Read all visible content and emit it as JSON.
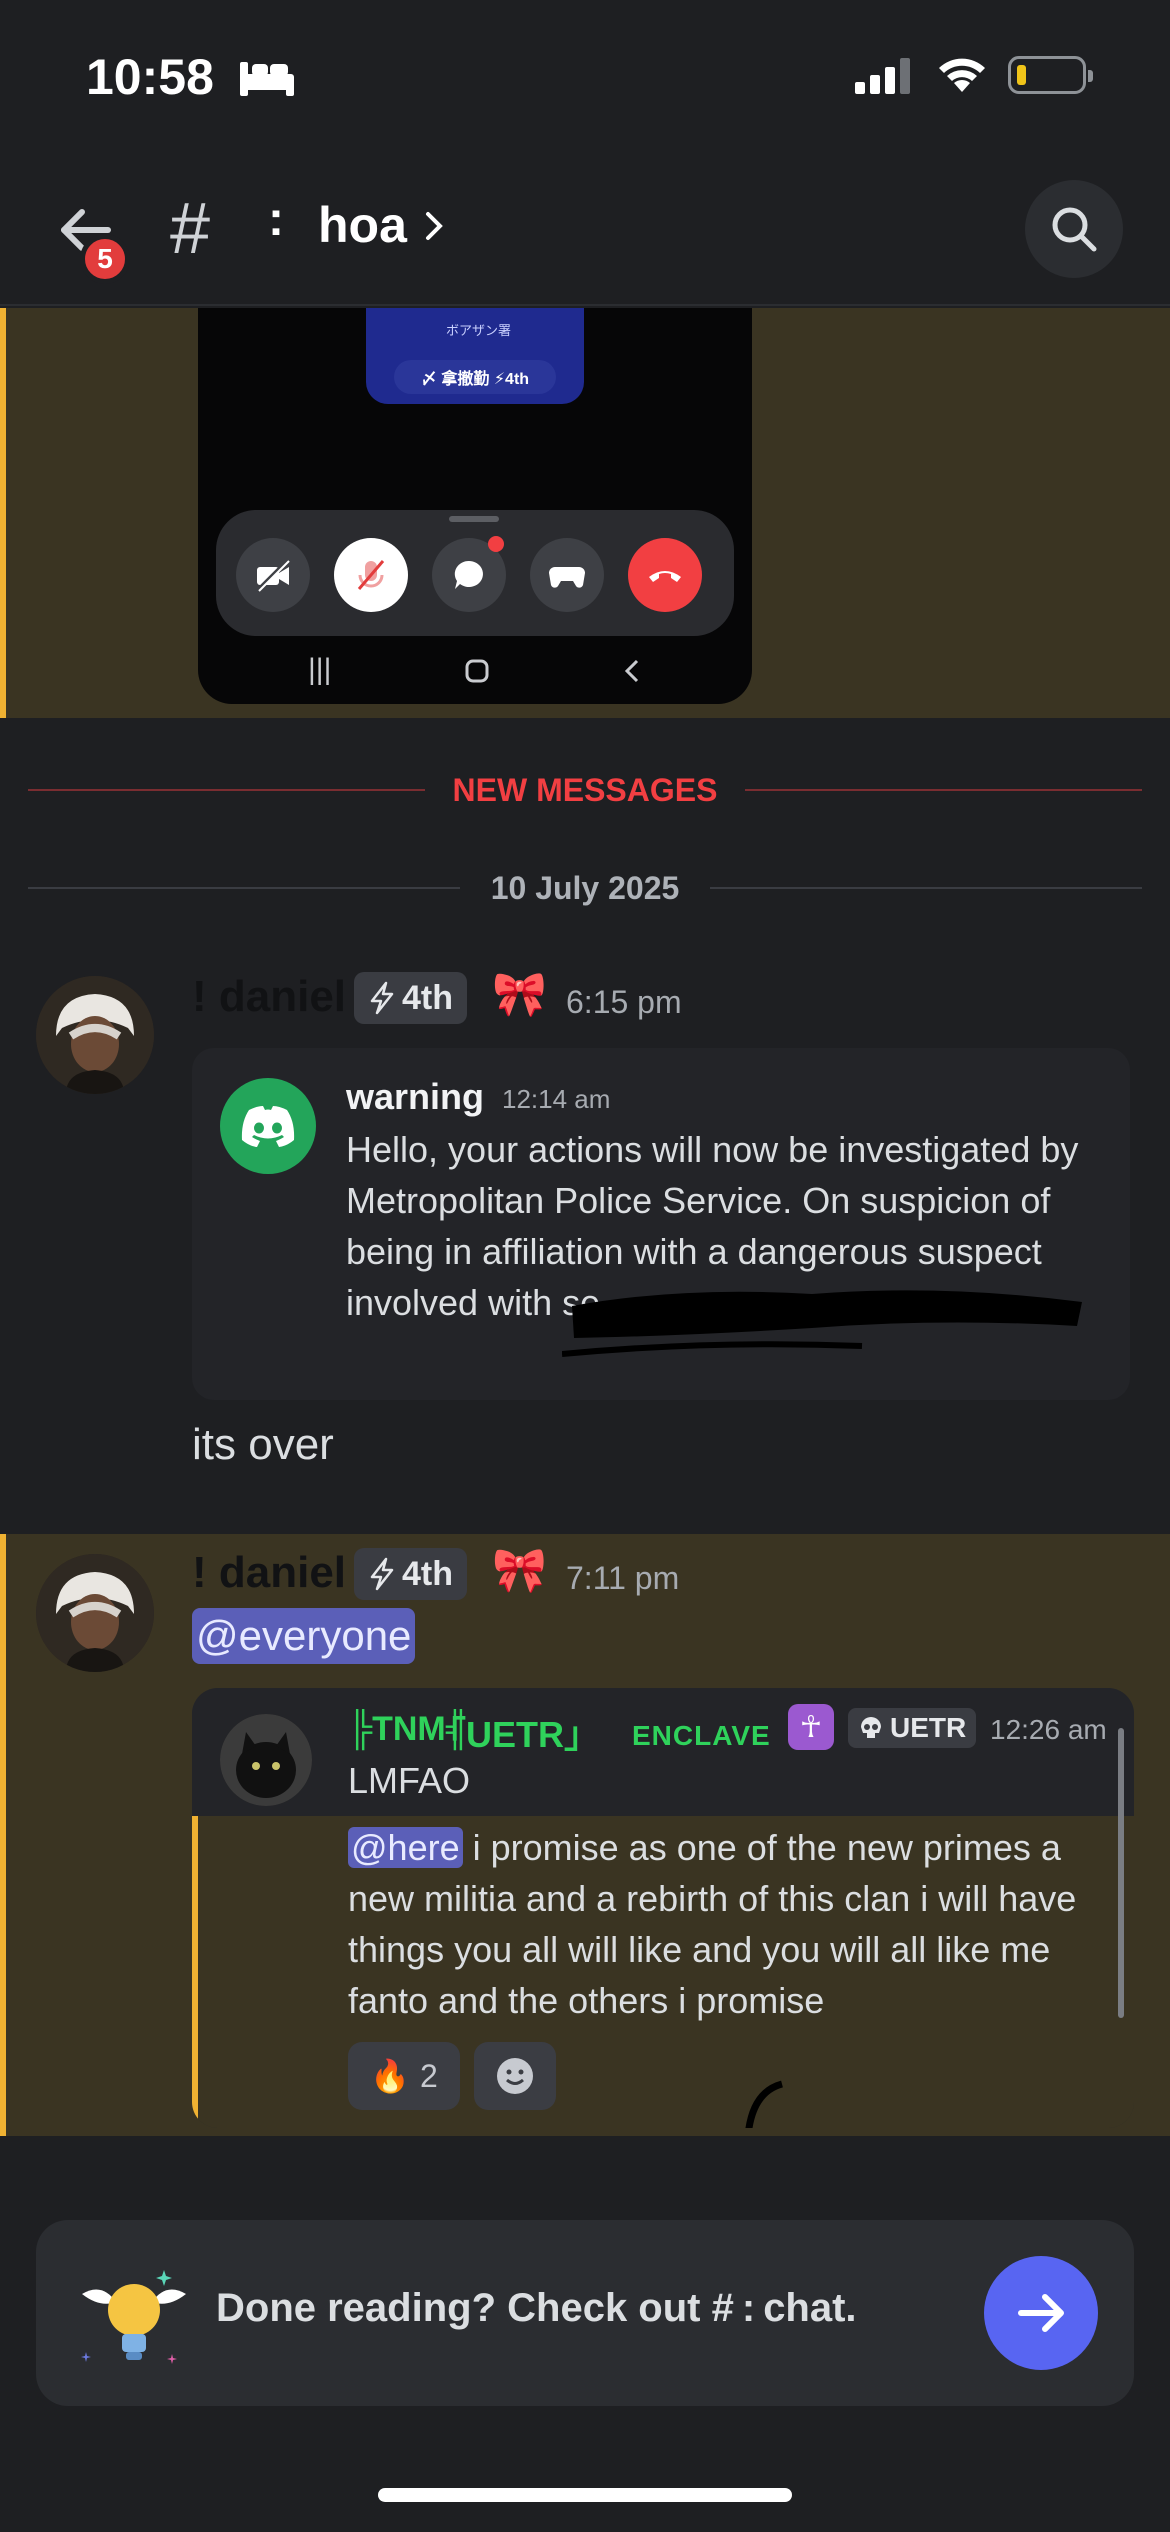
{
  "status_bar": {
    "time": "10:58"
  },
  "header": {
    "unread_count": "5",
    "hash": "#",
    "separator": ":",
    "channel": "hoa"
  },
  "top_image": {
    "card_small": "ボアザン署",
    "card_tag": "〆 拿撤勤 ⚡4th"
  },
  "separators": {
    "new_messages": "NEW MESSAGES",
    "date": "10 July 2025"
  },
  "message1": {
    "username": "! daniel",
    "role": "4th",
    "time": "6:15 pm",
    "embed": {
      "title": "warning",
      "time": "12:14 am",
      "text": "Hello, your actions will now be investigated by Metropolitan Police Service. On suspicion of being in affiliation with a dangerous suspect involved with se..."
    },
    "followup": "its over"
  },
  "message2": {
    "username": "! daniel",
    "role": "4th",
    "time": "7:11 pm",
    "mention": "@everyone",
    "forwarded": {
      "name_part1": "╠TNM╣",
      "name_part2": "「UETR」",
      "name_part3": "ENCLAVE",
      "cross": "☥",
      "tag": "UETR",
      "time": "12:26 am",
      "reply_text": "LMFAO",
      "mention": "@here",
      "text": "i promise as one of the new primes a new militia and a rebirth of this clan i will have things you all will like and you will all like me fanto and the others i promise",
      "reaction_count": "2"
    }
  },
  "banner": {
    "text": "Done reading? Check out # : chat."
  }
}
